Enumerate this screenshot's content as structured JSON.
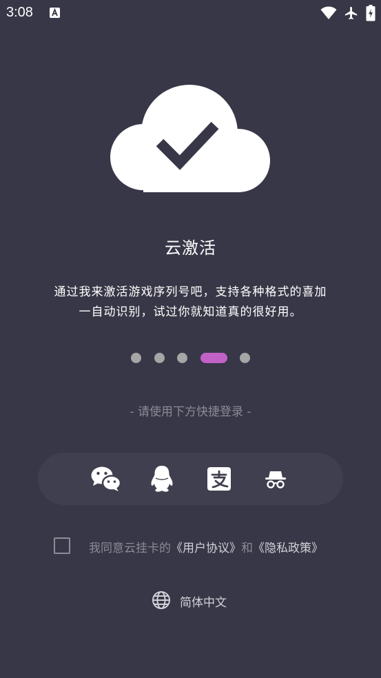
{
  "status_bar": {
    "time": "3:08",
    "icons": [
      "text-a-icon",
      "wifi-icon",
      "airplane-icon",
      "battery-charging-icon"
    ]
  },
  "hero": {
    "icon": "cloud-check-icon",
    "title": "云激活",
    "description_line1": "通过我来激活游戏序列号吧，支持各种格式的喜加",
    "description_line2": "一自动识别，试过你就知道真的很好用。"
  },
  "pager": {
    "count": 5,
    "active_index": 3,
    "color_active": "#c262c7",
    "color_inactive": "#a6a6a6"
  },
  "login": {
    "hint": "- 请使用下方快捷登录 -",
    "methods": [
      "wechat-icon",
      "qq-icon",
      "alipay-icon",
      "incognito-icon"
    ]
  },
  "agreement": {
    "prefix": "我同意云挂卡的",
    "user_agreement": "《用户协议》",
    "and": "和",
    "privacy_policy": "《隐私政策》",
    "checked": false
  },
  "language": {
    "icon": "globe-icon",
    "label": "简体中文"
  },
  "colors": {
    "background": "#383747",
    "panel": "#403f4f",
    "accent": "#c262c7"
  }
}
